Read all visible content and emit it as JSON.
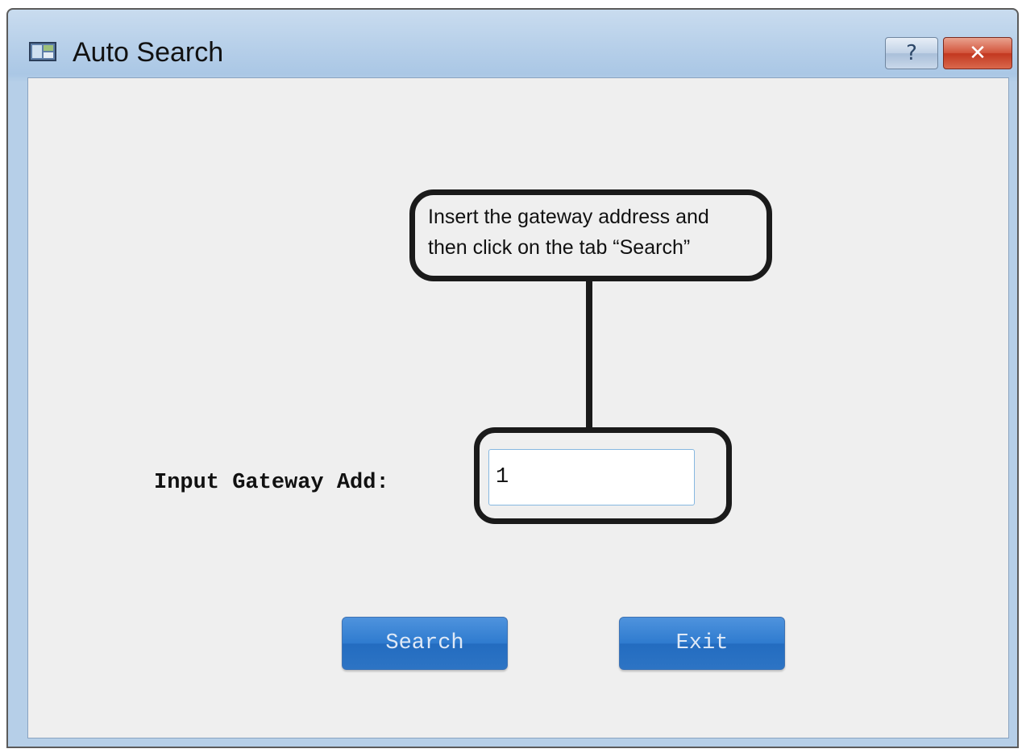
{
  "window": {
    "title": "Auto Search",
    "icons": {
      "app": "window-app-icon",
      "help": "help-icon",
      "close": "close-icon"
    },
    "help_glyph": "?",
    "close_glyph": "✕"
  },
  "callout": {
    "text": "Insert the gateway address and\nthen click on the tab “Search”"
  },
  "form": {
    "gateway_label": "Input Gateway Add:",
    "gateway_value": "1"
  },
  "buttons": {
    "search_label": "Search",
    "exit_label": "Exit"
  },
  "colors": {
    "button_blue": "#2f7bcf",
    "close_red": "#c2371f",
    "client_bg": "#efefef"
  }
}
